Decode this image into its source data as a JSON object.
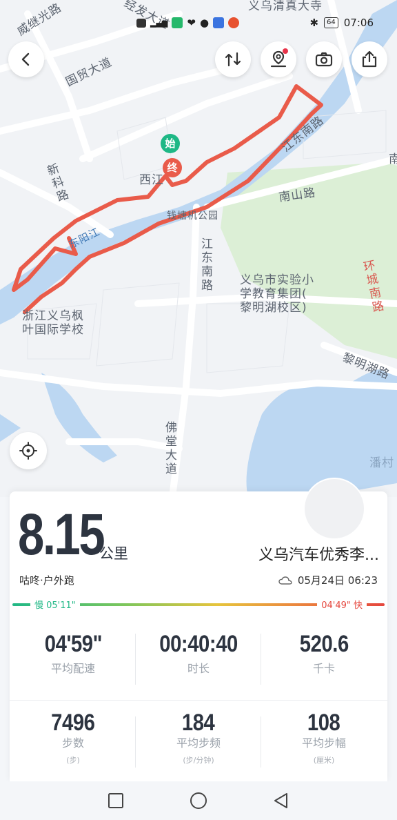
{
  "status_bar": {
    "left_icons": [
      "hd-icon",
      "signal-icon",
      "app-icon",
      "heart-icon",
      "wechat-icon",
      "chat-icon",
      "weibo-icon"
    ],
    "battery": "64",
    "time": "07:06"
  },
  "map": {
    "labels": {
      "top_road_1": "义乌清真大寺",
      "weiji_road": "威继光路",
      "jingfa_road": "经发大道",
      "guomao_road": "国贸大道",
      "xinke_road": "新科路",
      "xi_road": "西江",
      "jiang_road": "江",
      "jiangdong_south_1": "江东南路",
      "nanshan_road": "南山路",
      "river": "东阳江",
      "park": "钱塘机公园",
      "jiangdong_south_2": "江东南路",
      "school": "义乌市实验小学教育集团(黎明湖校区)",
      "school_line1": "义乌市实验小",
      "school_line2": "学教育集团(",
      "school_line3": "黎明湖校区)",
      "huancheng_road": "环城南路",
      "international_school_line1": "浙江义乌枫",
      "international_school_line2": "叶国际学校",
      "liminghu_road": "黎明湖路",
      "fotang_road": "佛堂大道",
      "pancun": "潘村",
      "nan_edge": "南"
    },
    "start_label": "始",
    "end_label": "终",
    "route_color": "#e95b4a"
  },
  "buttons": {
    "back": "back-icon",
    "route_switch": "route-switch-icon",
    "location_badge": "location-badge-icon",
    "camera": "camera-icon",
    "share": "share-icon",
    "locate": "locate-icon"
  },
  "summary": {
    "distance": "8.15",
    "distance_unit": "公里",
    "place": "义乌汽车优秀李...",
    "sport": "咕咚·户外跑",
    "datetime": "05月24日 06:23",
    "pace_slow": "慢 05'11\"",
    "pace_fast": "04'49\" 快"
  },
  "stats_row1": [
    {
      "value": "04'59\"",
      "label": "平均配速"
    },
    {
      "value": "00:40:40",
      "label": "时长"
    },
    {
      "value": "520.6",
      "label": "千卡"
    }
  ],
  "stats_row2": [
    {
      "value": "7496",
      "label": "步数",
      "unit": "(步)"
    },
    {
      "value": "184",
      "label": "平均步频",
      "unit": "(步/分钟)"
    },
    {
      "value": "108",
      "label": "平均步幅",
      "unit": "(厘米)"
    }
  ],
  "nav": {
    "recent": "square-icon",
    "home": "circle-icon",
    "back": "triangle-back-icon"
  }
}
